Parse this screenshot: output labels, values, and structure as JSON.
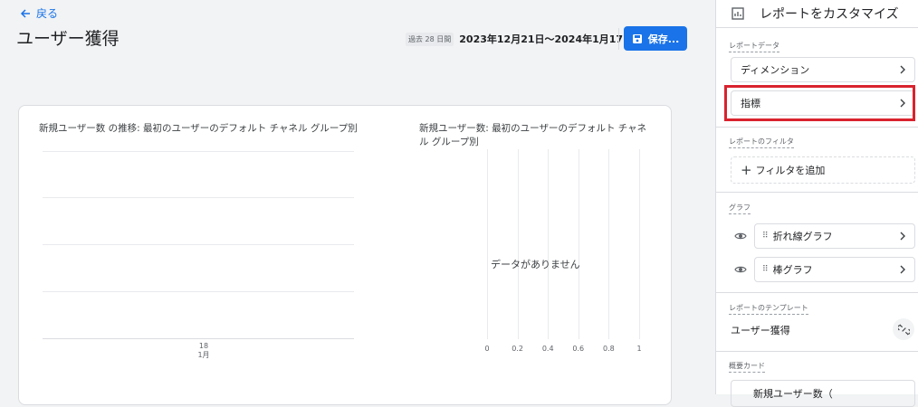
{
  "nav": {
    "back_label": "戻る"
  },
  "page": {
    "title": "ユーザー獲得"
  },
  "date": {
    "period_label": "過去 28 日間",
    "range": "2023年12月21日～2024年1月17日"
  },
  "toolbar": {
    "save_label": "保存..."
  },
  "charts": {
    "line_title": "新規ユーザー数 の推移: 最初のユーザーのデフォルト チャネル グループ別",
    "bar_title_line1": "新規ユーザー数: 最初のユーザーのデフォルト チャネ",
    "bar_title_line2": "ル グループ別",
    "x_tick_day": "18",
    "x_tick_month": "1月",
    "no_data": "データがありません",
    "bar_ticks": [
      "0",
      "0.2",
      "0.4",
      "0.6",
      "0.8",
      "1"
    ]
  },
  "chart_data": [
    {
      "type": "line",
      "title": "新規ユーザー数 の推移: 最初のユーザーのデフォルト チャネル グループ別",
      "categories": [
        "18 1月"
      ],
      "series": []
    },
    {
      "type": "bar",
      "title": "新規ユーザー数: 最初のユーザーのデフォルト チャネル グループ別",
      "xlim": [
        0,
        1
      ],
      "x_ticks": [
        0,
        0.2,
        0.4,
        0.6,
        0.8,
        1
      ],
      "categories": [],
      "values": []
    }
  ],
  "sidebar": {
    "header": "レポートをカスタマイズ",
    "report_data_label": "レポートデータ",
    "dimension": "ディメンション",
    "metric": "指標",
    "filter_label": "レポートのフィルタ",
    "add_filter": "フィルタを追加",
    "graph_label": "グラフ",
    "line_graph": "折れ線グラフ",
    "bar_graph": "棒グラフ",
    "template_label": "レポートのテンプレート",
    "template_name": "ユーザー獲得",
    "overview_label": "概要カード",
    "overview_card": "新規ユーザー数（"
  },
  "colors": {
    "accent": "#1a73e8",
    "highlight": "#d9232e"
  }
}
